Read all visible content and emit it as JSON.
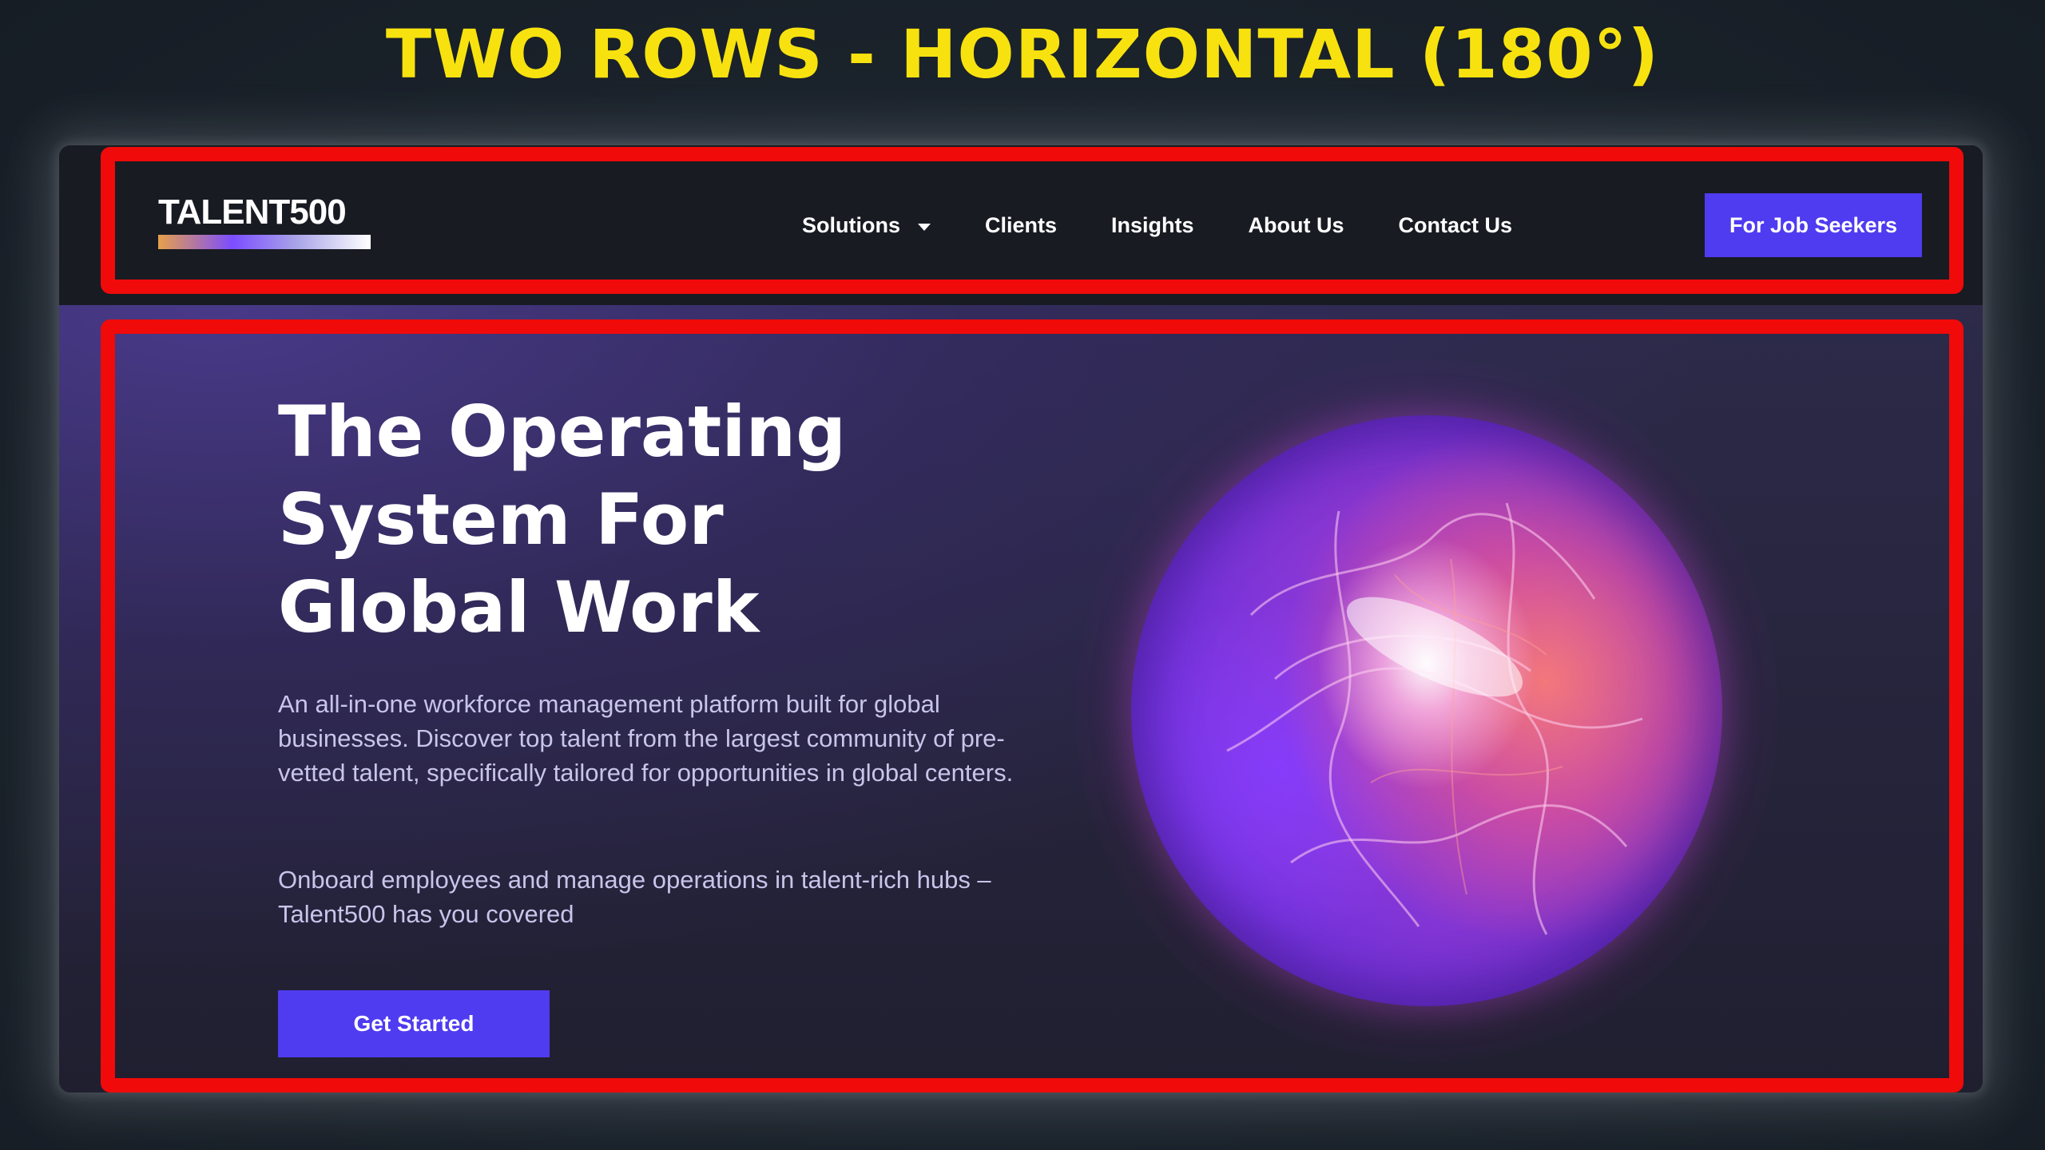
{
  "banner": {
    "title": "TWO ROWS - HORIZONTAL (180°)"
  },
  "navbar": {
    "logo_text": "TALENT500",
    "links": [
      {
        "label": "Solutions",
        "has_dropdown": true
      },
      {
        "label": "Clients"
      },
      {
        "label": "Insights"
      },
      {
        "label": "About Us"
      },
      {
        "label": "Contact Us"
      }
    ],
    "job_seekers_button": "For Job Seekers"
  },
  "hero": {
    "title": "The Operating System For Global Work",
    "description": "An all-in-one workforce management platform built for global businesses. Discover top talent from the largest community of pre-vetted talent, specifically tailored for opportunities in global centers.",
    "description2": "Onboard employees and manage operations in talent-rich hubs – Talent500 has you covered",
    "cta_label": "Get Started"
  },
  "colors": {
    "banner_text": "#f7e20f",
    "highlight_outline": "#f00a0a",
    "accent_button": "#4f3bf0",
    "navbar_bg": "#181b22",
    "hero_bg": "#26243b"
  },
  "icons": {
    "dropdown": "caret-down-icon",
    "hero_visual": "glowing-orb-image"
  }
}
